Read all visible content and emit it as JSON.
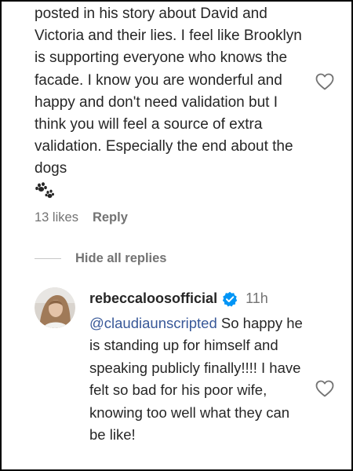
{
  "comment": {
    "text": "posted in his story about David and Victoria and their lies. I feel like Brooklyn is supporting everyone who knows the facade. I know you are wonderful and happy and don't need validation but I think you will feel a source of extra validation. Especially the end about the dogs",
    "emoji_icon": "paw-prints-icon",
    "likes": "13 likes",
    "reply_label": "Reply",
    "like_icon": "heart-outline-icon"
  },
  "replies_toggle": {
    "label": "Hide all replies"
  },
  "reply": {
    "username": "rebeccaloosofficial",
    "verified_icon": "verified-badge-icon",
    "time": "11h",
    "mention": "@claudiaunscripted",
    "text": " So happy he is standing up for himself and speaking publicly finally!!!! I have felt so bad for his poor wife, knowing too well what they can be like!",
    "like_icon": "heart-outline-icon"
  },
  "colors": {
    "text": "#262626",
    "secondary": "#737373",
    "mention": "#385898",
    "verified": "#0095f6"
  }
}
